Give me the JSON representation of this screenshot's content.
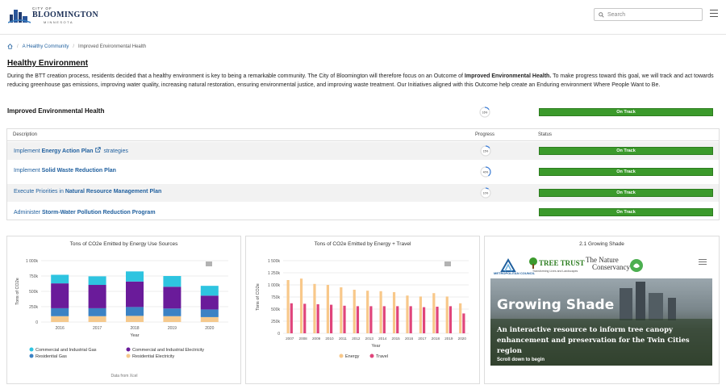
{
  "header": {
    "logo_top": "CITY OF",
    "logo_name": "BLOOMINGTON",
    "logo_sub": "MINNESOTA",
    "search_placeholder": "Search"
  },
  "breadcrumb": {
    "home": "Home",
    "items": [
      "A Healthy Community",
      "Improved Environmental Health"
    ]
  },
  "page": {
    "title": "Healthy Environment",
    "description_pre": "During the BTT creation process, residents decided that a healthy environment is key to being a remarkable community. The City of Bloomington will therefore focus on an Outcome of ",
    "description_bold": "Improved Environmental Health.",
    "description_post": " To make progress toward this goal, we will track and act towards reducing greenhouse gas emissions, improving water quality, increasing natural restoration, ensuring environmental justice, and improving waste treatment. Our Initiatives aligned with this Outcome help create an Enduring environment Where People Want to Be."
  },
  "outcome": {
    "name": "Improved Environmental Health",
    "progress": "16%",
    "progress_value": 16,
    "status": "On Track"
  },
  "table": {
    "headers": {
      "description": "Description",
      "progress": "Progress",
      "status": "Status"
    },
    "rows": [
      {
        "prefix": "Implement ",
        "bold": "Energy Action Plan",
        "suffix": " strategies",
        "external": true,
        "progress": "15%",
        "progress_value": 15,
        "status": "On Track"
      },
      {
        "prefix": "Implement ",
        "bold": "Solid Waste Reduction Plan",
        "suffix": "",
        "external": false,
        "progress": "40%",
        "progress_value": 40,
        "status": "On Track"
      },
      {
        "prefix": "Execute Priorities in ",
        "bold": "Natural Resource Management Plan",
        "suffix": "",
        "external": false,
        "progress": "10%",
        "progress_value": 10,
        "status": "On Track"
      },
      {
        "prefix": "Administer ",
        "bold": "Storm-Water Pollution Reduction Program",
        "suffix": "",
        "external": false,
        "progress": "",
        "progress_value": null,
        "status": "On Track"
      }
    ]
  },
  "colors": {
    "on_track": "#3b9a2b",
    "link": "#1f5f9e",
    "comm_gas": "#2ec4e0",
    "comm_elec": "#6a1b9a",
    "res_gas": "#3b82c4",
    "res_elec": "#f5c98d",
    "energy": "#f8c88a",
    "travel": "#e0457b"
  },
  "chart1_footer": "Data from Xcel",
  "chart_data": [
    {
      "type": "bar",
      "title": "Tons of CO2e Emitted by Energy Use Sources",
      "xlabel": "Year",
      "ylabel": "Tons of CO2e",
      "categories": [
        "2016",
        "2017",
        "2018",
        "2019",
        "2020"
      ],
      "yticks": [
        "0",
        "250k",
        "500k",
        "750k",
        "1 000k"
      ],
      "ylim": [
        0,
        1000000
      ],
      "stacked": true,
      "series": [
        {
          "name": "Residential Electricity",
          "values": [
            95000,
            95000,
            100000,
            95000,
            80000
          ]
        },
        {
          "name": "Residential Gas",
          "values": [
            130000,
            130000,
            145000,
            125000,
            125000
          ]
        },
        {
          "name": "Commercial and Industrial Electricity",
          "values": [
            405000,
            380000,
            415000,
            355000,
            225000
          ]
        },
        {
          "name": "Commercial and Industrial Gas",
          "values": [
            140000,
            140000,
            165000,
            175000,
            160000
          ]
        }
      ],
      "legend": "bottom"
    },
    {
      "type": "bar",
      "title": "Tons of CO2e Emitted by Energy + Travel",
      "xlabel": "Year",
      "ylabel": "Tons of CO2e",
      "categories": [
        "2007",
        "2008",
        "2009",
        "2010",
        "2011",
        "2012",
        "2013",
        "2014",
        "2015",
        "2016",
        "2017",
        "2018",
        "2019",
        "2020"
      ],
      "yticks": [
        "0",
        "250k",
        "500k",
        "750k",
        "1 000k",
        "1 250k",
        "1 500k"
      ],
      "ylim": [
        0,
        1500000
      ],
      "series": [
        {
          "name": "Energy",
          "values": [
            1100000,
            1130000,
            1020000,
            1000000,
            950000,
            900000,
            880000,
            870000,
            850000,
            780000,
            760000,
            830000,
            760000,
            620000
          ]
        },
        {
          "name": "Travel",
          "values": [
            620000,
            610000,
            600000,
            590000,
            570000,
            560000,
            560000,
            560000,
            560000,
            560000,
            540000,
            550000,
            560000,
            410000
          ]
        }
      ],
      "legend": "bottom"
    }
  ],
  "growing": {
    "panel_title": "2.1 Growing Shade",
    "org1": "METROPOLITAN COUNCIL",
    "org2": "TREE TRUST",
    "org2_tagline": "Transforming Lives and Landscapes",
    "org3_line1": "The Nature",
    "org3_line2": "Conservancy",
    "headline": "Growing Shade",
    "subtext": "An interactive resource to inform tree canopy enhancement and preservation for the Twin Cities region",
    "cta": "Scroll down to begin"
  }
}
